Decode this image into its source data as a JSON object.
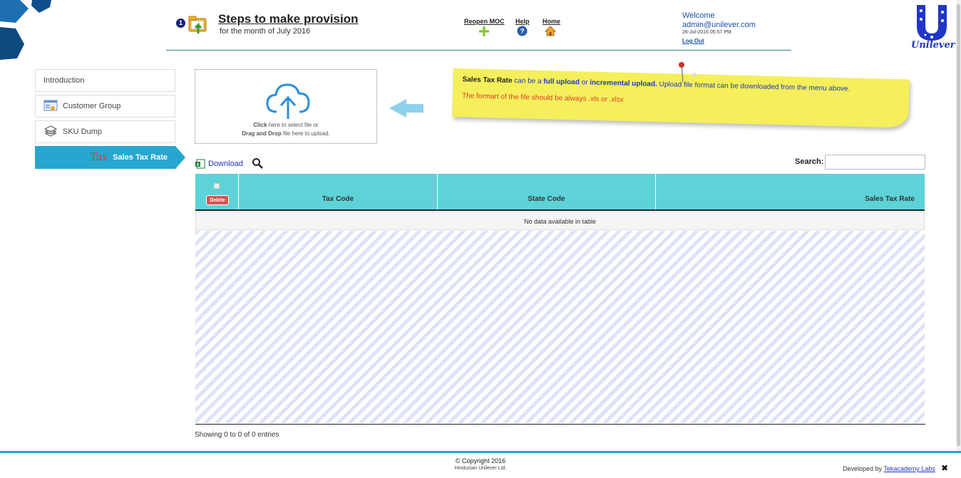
{
  "header": {
    "step_number": "1",
    "title": "Steps to make provision",
    "subtitle": "for the month of July 2016",
    "nav": [
      {
        "label": "Reopen MOC",
        "icon": "plus-icon"
      },
      {
        "label": "Help",
        "icon": "help-icon"
      },
      {
        "label": "Home",
        "icon": "home-icon"
      }
    ],
    "welcome": "Welcome",
    "email": "admin@unilever.com",
    "datetime": "26-Jul-2016 05:57 PM",
    "logout": "Log Out",
    "brand": "Unilever"
  },
  "sidebar": {
    "items": [
      {
        "label": "Introduction"
      },
      {
        "label": "Customer Group",
        "icon": "customer-group-icon"
      },
      {
        "label": "SKU Dump",
        "icon": "sku-dump-icon"
      },
      {
        "label": "Sales Tax Rate",
        "prefix": "Tax",
        "active": true
      }
    ]
  },
  "upload": {
    "click_bold": "Click",
    "click_rest": " here to select file or",
    "drag_bold": "Drag and Drop",
    "drag_rest": " file here to upload."
  },
  "note": {
    "name": "Sales Tax Rate",
    "can_be": " can be a ",
    "full": "full upload",
    "or": " or ",
    "incremental": "incremental upload.",
    "rest": " Upload file format can be downloaded from the menu above.",
    "format": "The formart of the file should be always .xls or .xlsx"
  },
  "table": {
    "download_label": "Download",
    "search_label": "Search:",
    "search_value": "",
    "delete_label": "Delete",
    "columns": [
      "Tax Code",
      "State Code",
      "Sales Tax Rate"
    ],
    "empty_text": "No data available in table",
    "info": "Showing 0 to 0 of 0 entries"
  },
  "footer": {
    "copyright": "Copyright 2016",
    "company": "Hindustan Unilever Ltd.",
    "developed_by": "Developed by ",
    "developer": "Tekacademy Labs",
    "close": "✖"
  },
  "colors": {
    "accent": "#27a6cf",
    "table_header": "#5dd3d8",
    "note": "#f4ef5a",
    "delete": "#d9534f"
  }
}
